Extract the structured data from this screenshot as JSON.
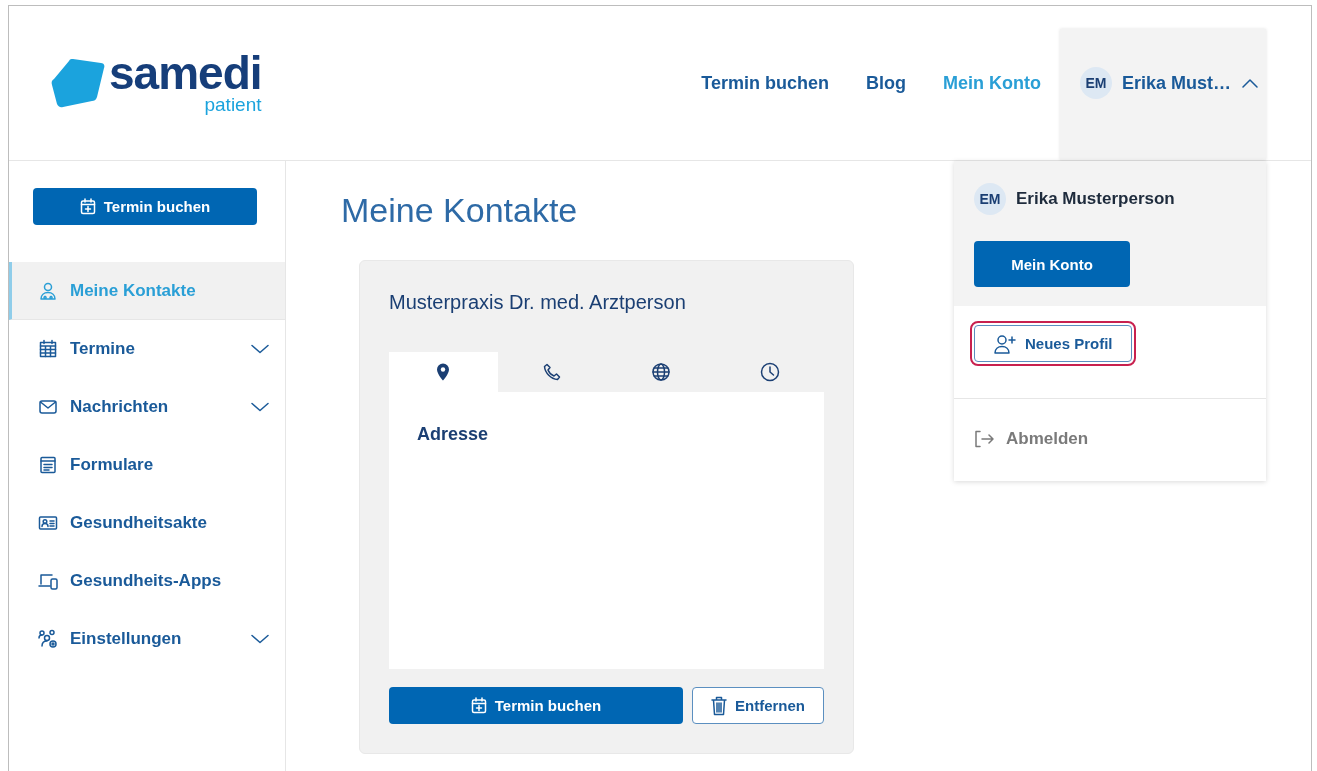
{
  "logo": {
    "name": "samedi",
    "subtitle": "patient"
  },
  "nav": [
    {
      "label": "Termin buchen",
      "selected": false
    },
    {
      "label": "Blog",
      "selected": false
    },
    {
      "label": "Mein Konto",
      "selected": true
    }
  ],
  "user_menu": {
    "initials": "EM",
    "name": "Erika Must…",
    "expanded": true,
    "dropdown": {
      "initials": "EM",
      "full_name": "Erika Musterperson",
      "account_button": "Mein Konto",
      "new_profile_button": "Neues Profil",
      "new_profile_highlighted": true,
      "logout": "Abmelden"
    }
  },
  "sidebar": {
    "book_button": "Termin buchen",
    "items": [
      {
        "kind": "contacts",
        "label": "Meine Kontakte",
        "selected": true,
        "has_submenu": false
      },
      {
        "kind": "calendar",
        "label": "Termine",
        "selected": false,
        "has_submenu": true
      },
      {
        "kind": "mail",
        "label": "Nachrichten",
        "selected": false,
        "has_submenu": true
      },
      {
        "kind": "form",
        "label": "Formulare",
        "selected": false,
        "has_submenu": false
      },
      {
        "kind": "record",
        "label": "Gesundheitsakte",
        "selected": false,
        "has_submenu": false
      },
      {
        "kind": "devices",
        "label": "Gesundheits-Apps",
        "selected": false,
        "has_submenu": false
      },
      {
        "kind": "settings",
        "label": "Einstellungen",
        "selected": false,
        "has_submenu": true
      }
    ]
  },
  "page_title": "Meine Kontakte",
  "contact_card": {
    "title": "Musterpraxis Dr. med. Arztperson",
    "tabs": [
      {
        "kind": "pin",
        "selected": true
      },
      {
        "kind": "phone",
        "selected": false
      },
      {
        "kind": "globe",
        "selected": false
      },
      {
        "kind": "clock",
        "selected": false
      }
    ],
    "section_heading": "Adresse",
    "book_button": "Termin buchen",
    "remove_button": "Entfernen"
  }
}
